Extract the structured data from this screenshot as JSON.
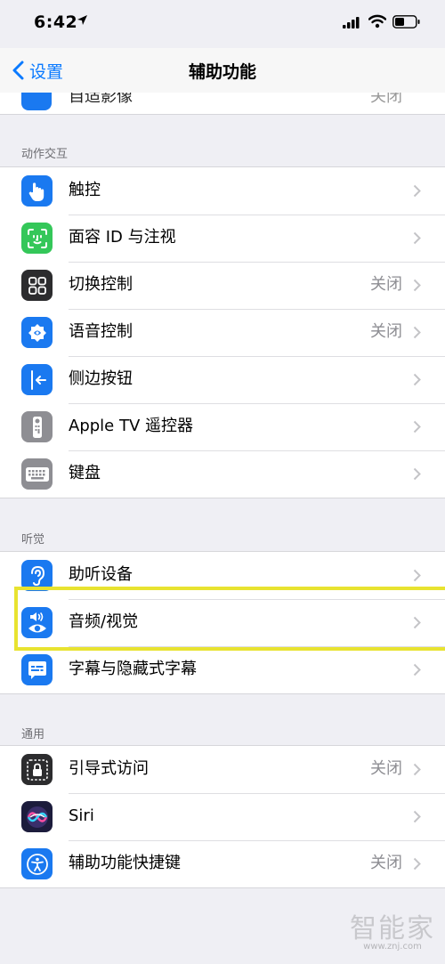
{
  "status": {
    "time": "6:42"
  },
  "nav": {
    "back_label": "设置",
    "title": "辅助功能"
  },
  "partial_row": {
    "label": "自适影像",
    "value": "关闭"
  },
  "sections": [
    {
      "header": "动作交互",
      "items": [
        {
          "label": "触控",
          "value": "",
          "icon": "touch-hand-icon",
          "color": "#1a79f0"
        },
        {
          "label": "面容 ID 与注视",
          "value": "",
          "icon": "face-id-icon",
          "color": "#34c759"
        },
        {
          "label": "切换控制",
          "value": "关闭",
          "icon": "switch-control-icon",
          "color": "#2c2c2e"
        },
        {
          "label": "语音控制",
          "value": "关闭",
          "icon": "voice-control-icon",
          "color": "#1a79f0"
        },
        {
          "label": "侧边按钮",
          "value": "",
          "icon": "side-button-icon",
          "color": "#1a79f0"
        },
        {
          "label": "Apple TV 遥控器",
          "value": "",
          "icon": "tv-remote-icon",
          "color": "#8e8e93"
        },
        {
          "label": "键盘",
          "value": "",
          "icon": "keyboard-icon",
          "color": "#8e8e93"
        }
      ]
    },
    {
      "header": "听觉",
      "items": [
        {
          "label": "助听设备",
          "value": "",
          "icon": "ear-icon",
          "color": "#1a79f0"
        },
        {
          "label": "音频/视觉",
          "value": "",
          "icon": "audio-visual-icon",
          "color": "#1a79f0"
        },
        {
          "label": "字幕与隐藏式字幕",
          "value": "",
          "icon": "subtitles-icon",
          "color": "#1a79f0"
        }
      ]
    },
    {
      "header": "通用",
      "items": [
        {
          "label": "引导式访问",
          "value": "关闭",
          "icon": "guided-access-icon",
          "color": "#2c2c2e"
        },
        {
          "label": "Siri",
          "value": "",
          "icon": "siri-icon",
          "color": "#1c1c3c"
        },
        {
          "label": "辅助功能快捷键",
          "value": "关闭",
          "icon": "accessibility-shortcut-icon",
          "color": "#1a79f0"
        }
      ]
    }
  ],
  "watermark": {
    "big": "智能家",
    "small": "www.znj.com"
  }
}
